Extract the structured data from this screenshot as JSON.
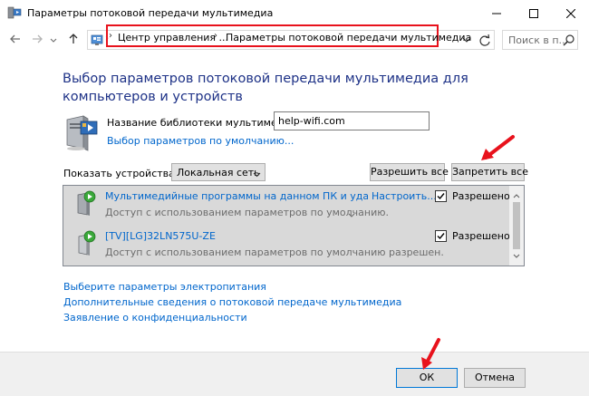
{
  "window": {
    "title": "Параметры потоковой передачи мультимедиа",
    "icons": {
      "app": "media-server-icon",
      "minimize": "minimize-icon",
      "maximize": "maximize-icon",
      "close": "close-icon"
    }
  },
  "navigation": {
    "breadcrumbs": [
      "Центр управления ...",
      "Параметры потоковой передачи мультимедиа"
    ],
    "search_placeholder": "Поиск в п...",
    "icons": {
      "back": "back-arrow-icon",
      "forward": "forward-arrow-icon",
      "recent": "chevron-down-icon",
      "up": "up-arrow-icon",
      "refresh": "refresh-icon",
      "search": "search-icon"
    }
  },
  "main": {
    "heading": "Выбор параметров потоковой передачи мультимедиа для компьютеров и устройств",
    "library_label": "Название библиотеки мультимедиа:",
    "library_name": "help-wifi.com",
    "default_settings_link": "Выбор параметров по умолчанию...",
    "show_devices_label": "Показать устройства на:",
    "network_selected": "Локальная сеть",
    "allow_all_label": "Разрешить все",
    "block_all_label": "Запретить все"
  },
  "devices": [
    {
      "name": "Мультимедийные программы на данном ПК и удаленны...",
      "description": "Доступ с использованием параметров по умолчанию.",
      "setup_link": "Настроить...",
      "checked": true,
      "status_label": "Разрешено",
      "icon": "pc-media-device-icon"
    },
    {
      "name": "[TV][LG]32LN575U-ZE",
      "description": "Доступ с использованием параметров по умолчанию разрешен.",
      "setup_link": "",
      "checked": true,
      "status_label": "Разрешено",
      "icon": "tv-media-device-icon"
    }
  ],
  "links": [
    "Выберите параметры электропитания",
    "Дополнительные сведения о потоковой передаче мультимедиа",
    "Заявление о конфиденциальности"
  ],
  "footer": {
    "ok_label": "ОК",
    "cancel_label": "Отмена"
  },
  "colors": {
    "heading": "#1e3287",
    "link": "#0066cc",
    "highlight": "#e8121c",
    "list_background": "#d9d9d9",
    "button_face": "#e1e1e1"
  }
}
